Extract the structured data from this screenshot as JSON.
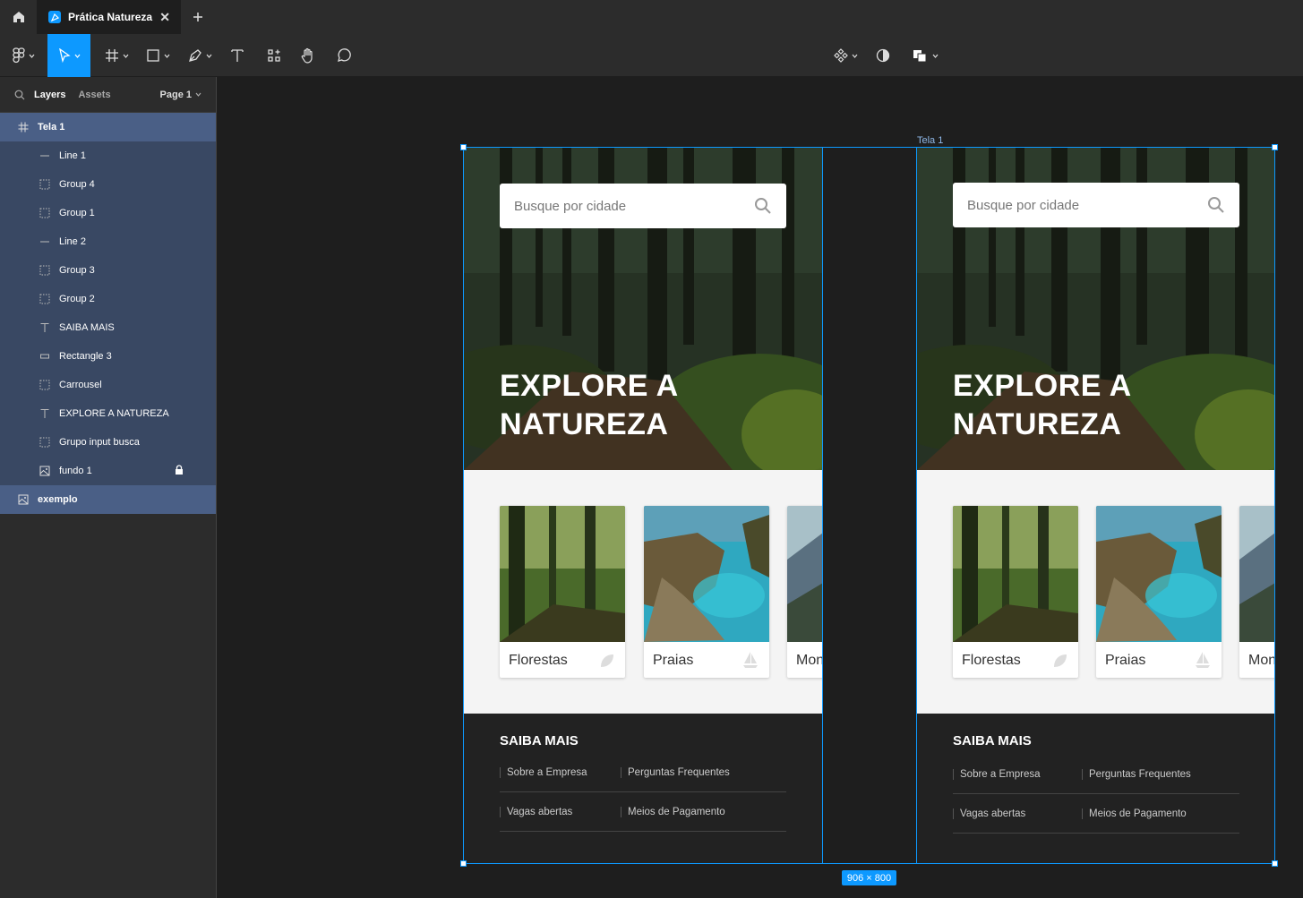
{
  "titlebar": {
    "tab_label": "Prática Natureza"
  },
  "left_panel": {
    "tabs": {
      "layers": "Layers",
      "assets": "Assets",
      "page": "Page 1"
    },
    "layers": [
      {
        "name": "Tela 1",
        "icon": "frame-icon"
      },
      {
        "name": "Line 1",
        "icon": "line-icon"
      },
      {
        "name": "Group 4",
        "icon": "group-icon"
      },
      {
        "name": "Group 1",
        "icon": "group-icon"
      },
      {
        "name": "Line 2",
        "icon": "line-icon"
      },
      {
        "name": "Group 3",
        "icon": "group-icon"
      },
      {
        "name": "Group 2",
        "icon": "group-icon"
      },
      {
        "name": "SAIBA MAIS",
        "icon": "text-icon"
      },
      {
        "name": "Rectangle 3",
        "icon": "rectangle-icon"
      },
      {
        "name": "Carrousel",
        "icon": "group-icon"
      },
      {
        "name": "EXPLORE A NATUREZA",
        "icon": "text-icon"
      },
      {
        "name": "Grupo input busca",
        "icon": "group-icon"
      },
      {
        "name": "fundo 1",
        "icon": "image-icon",
        "locked": true
      },
      {
        "name": "exemplo",
        "icon": "image-icon"
      }
    ]
  },
  "canvas": {
    "frame_label": "Tela 1",
    "dimensions": "906 × 800",
    "screen": {
      "search_placeholder": "Busque por cidade",
      "headline_line1": "EXPLORE A",
      "headline_line2": "NATUREZA",
      "cards": [
        "Florestas",
        "Praias",
        "Montanhas"
      ],
      "footer_title": "SAIBA MAIS",
      "links": [
        "Sobre a Empresa",
        "Perguntas Frequentes",
        "Vagas abertas",
        "Meios de Pagamento"
      ]
    }
  },
  "colors": {
    "accent": "#0d99ff",
    "panel": "#2c2c2c",
    "canvas": "#1e1e1e",
    "selection": "#394863"
  }
}
